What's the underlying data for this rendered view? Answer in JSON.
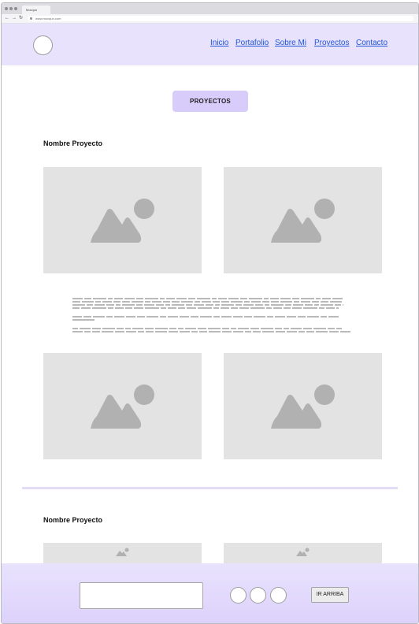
{
  "browser": {
    "tab_title": "Mocqun",
    "url": "www.mocqun.com",
    "back": "←",
    "forward": "→",
    "reload": "↻"
  },
  "header": {
    "nav": [
      "Inicio",
      "Portafolio",
      "Sobre Mi",
      "Proyectos",
      "Contacto"
    ]
  },
  "section": {
    "button_label": "PROYECTOS"
  },
  "projects": [
    {
      "title": "Nombre Proyecto"
    },
    {
      "title": "Nombre Proyecto"
    }
  ],
  "footer": {
    "button_label": "IR ARRIBA",
    "input_value": ""
  },
  "colors": {
    "header_bg": "#e8e2fd",
    "accent": "#d8ccfb",
    "link": "#2156d6",
    "placeholder": "#e3e3e3"
  }
}
